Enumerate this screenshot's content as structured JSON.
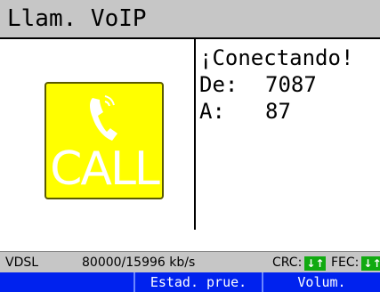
{
  "window": {
    "title": "Llam. VoIP"
  },
  "call": {
    "button_label": "CALL",
    "icon": "phone-handset-icon",
    "button_color": "#ffff00",
    "label_color": "#ffffff"
  },
  "info": {
    "status": "¡Conectando!",
    "from_label": "De:",
    "from_value": "7087",
    "to_label": "A:",
    "to_value": "87"
  },
  "status_bar": {
    "interface": "VDSL",
    "rate": "80000/15996 kb/s",
    "crc_label": "CRC:",
    "crc_indicator": "↓↑",
    "fec_label": "FEC:",
    "fec_indicator": "↓↑",
    "indicator_color": "#11aa11"
  },
  "softkeys": [
    "",
    "Estad. prue.",
    "Volum."
  ],
  "colors": {
    "title_bg": "#c6c6c6",
    "softkey_bg": "#0022ee"
  }
}
